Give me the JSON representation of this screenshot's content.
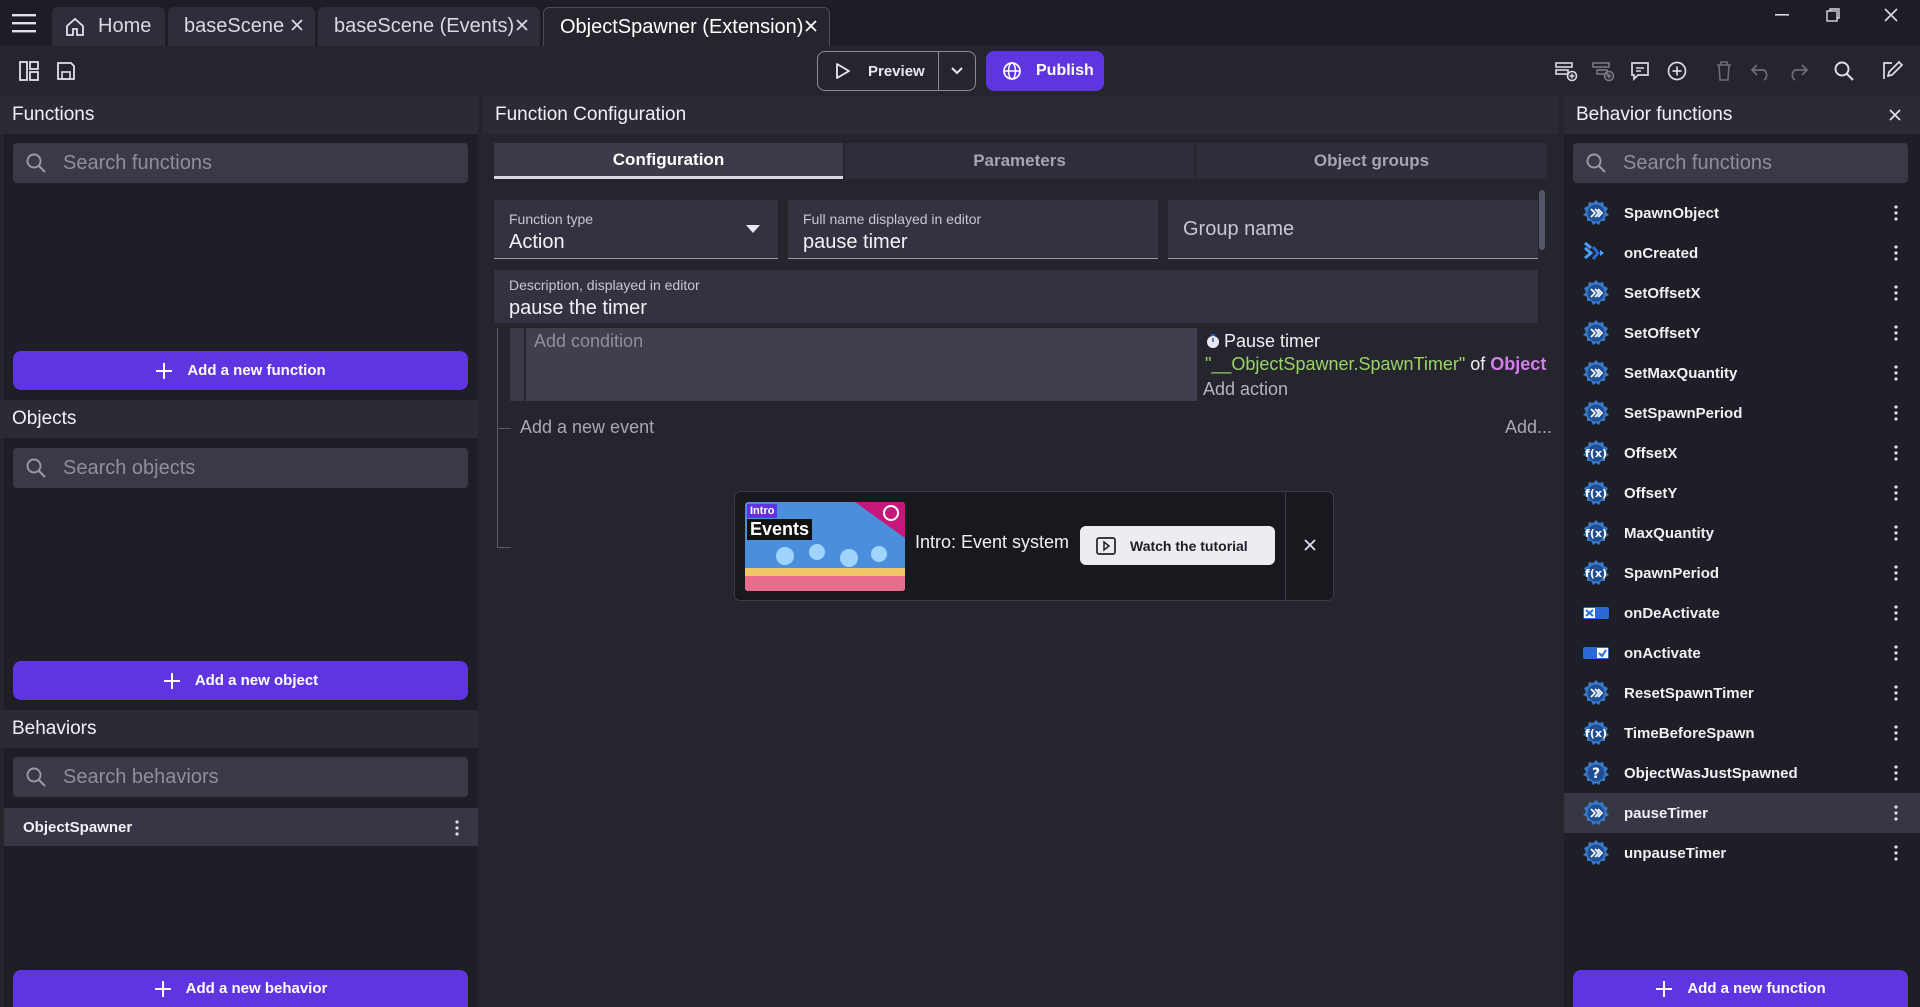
{
  "tabs": [
    {
      "label": "Home"
    },
    {
      "label": "baseScene"
    },
    {
      "label": "baseScene (Events)"
    },
    {
      "label": "ObjectSpawner (Extension)"
    }
  ],
  "toolbar": {
    "preview_label": "Preview",
    "publish_label": "Publish"
  },
  "left": {
    "functions": {
      "title": "Functions",
      "search_placeholder": "Search functions",
      "add_label": "Add a new function"
    },
    "objects": {
      "title": "Objects",
      "search_placeholder": "Search objects",
      "add_label": "Add a new object"
    },
    "behaviors": {
      "title": "Behaviors",
      "search_placeholder": "Search behaviors",
      "items": [
        {
          "label": "ObjectSpawner"
        }
      ],
      "add_label": "Add a new behavior"
    }
  },
  "center": {
    "title": "Function Configuration",
    "tabs": [
      {
        "label": "Configuration"
      },
      {
        "label": "Parameters"
      },
      {
        "label": "Object groups"
      }
    ],
    "function_type": {
      "label": "Function type",
      "value": "Action"
    },
    "full_name": {
      "label": "Full name displayed in editor",
      "value": "pause timer"
    },
    "group_name": {
      "placeholder": "Group name"
    },
    "description": {
      "label": "Description, displayed in editor",
      "value": "pause the timer"
    },
    "event": {
      "add_condition": "Add condition",
      "action_title": "Pause timer",
      "action_param": "\"__ObjectSpawner.SpawnTimer\"",
      "action_of": "of",
      "action_object": "Object",
      "add_action": "Add action"
    },
    "add_event": "Add a new event",
    "add_other": "Add...",
    "tutorial": {
      "thumb_badge": "Intro",
      "thumb_title": "Events",
      "title": "Intro: Event system",
      "button_label": "Watch the tutorial"
    }
  },
  "right": {
    "title": "Behavior functions",
    "search_placeholder": "Search functions",
    "items": [
      {
        "label": "SpawnObject",
        "icon": "fx"
      },
      {
        "label": "onCreated",
        "icon": "created"
      },
      {
        "label": "SetOffsetX",
        "icon": "fx"
      },
      {
        "label": "SetOffsetY",
        "icon": "fx"
      },
      {
        "label": "SetMaxQuantity",
        "icon": "fx"
      },
      {
        "label": "SetSpawnPeriod",
        "icon": "fx"
      },
      {
        "label": "OffsetX",
        "icon": "fx-expr"
      },
      {
        "label": "OffsetY",
        "icon": "fx-expr"
      },
      {
        "label": "MaxQuantity",
        "icon": "fx-expr"
      },
      {
        "label": "SpawnPeriod",
        "icon": "fx-expr"
      },
      {
        "label": "onDeActivate",
        "icon": "deactivate"
      },
      {
        "label": "onActivate",
        "icon": "activate"
      },
      {
        "label": "ResetSpawnTimer",
        "icon": "fx"
      },
      {
        "label": "TimeBeforeSpawn",
        "icon": "fx-expr"
      },
      {
        "label": "ObjectWasJustSpawned",
        "icon": "condition"
      },
      {
        "label": "pauseTimer",
        "icon": "fx"
      },
      {
        "label": "unpauseTimer",
        "icon": "fx"
      }
    ],
    "add_label": "Add a new function"
  },
  "colors": {
    "accent": "#5e35e0",
    "string_param": "#9bd36a",
    "object_param": "#d67bf0"
  }
}
